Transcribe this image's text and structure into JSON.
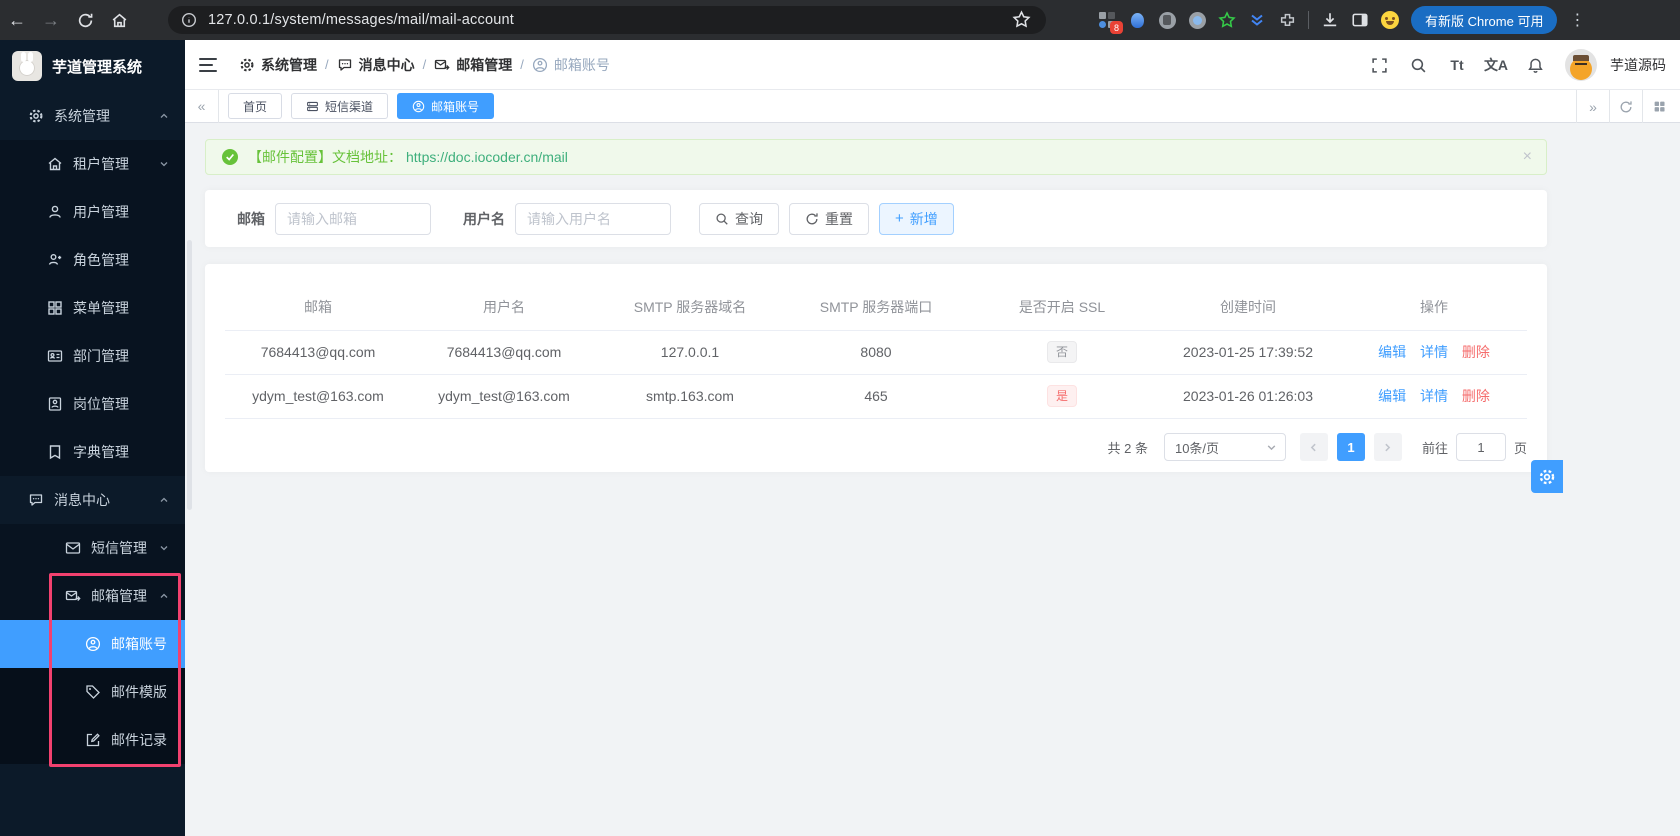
{
  "browser": {
    "url": "127.0.0.1/system/messages/mail/mail-account",
    "update_label": "有新版 Chrome 可用",
    "extension_badge": "8"
  },
  "glyphs": {
    "back": "←",
    "forward": "→",
    "collapse": "«",
    "expand": "»",
    "kebab": "⋮",
    "plus": "+",
    "slash": "/",
    "close": "×",
    "check": "✓"
  },
  "sidebar": {
    "logo_title": "芋道管理系统",
    "menu": [
      {
        "label": "系统管理"
      },
      {
        "label": "租户管理"
      },
      {
        "label": "用户管理"
      },
      {
        "label": "角色管理"
      },
      {
        "label": "菜单管理"
      },
      {
        "label": "部门管理"
      },
      {
        "label": "岗位管理"
      },
      {
        "label": "字典管理"
      },
      {
        "label": "消息中心"
      },
      {
        "label": "短信管理"
      },
      {
        "label": "邮箱管理"
      },
      {
        "label": "邮箱账号"
      },
      {
        "label": "邮件模版"
      },
      {
        "label": "邮件记录"
      }
    ]
  },
  "header": {
    "breadcrumb": [
      "系统管理",
      "消息中心",
      "邮箱管理",
      "邮箱账号"
    ],
    "font_icon": "Tt",
    "lang_icon": "文A",
    "username": "芋道源码"
  },
  "tabs": [
    {
      "label": "首页"
    },
    {
      "label": "短信渠道"
    },
    {
      "label": "邮箱账号"
    }
  ],
  "alert": {
    "text": "【邮件配置】文档地址：",
    "link": "https://doc.iocoder.cn/mail"
  },
  "filters": {
    "email_label": "邮箱",
    "email_placeholder": "请输入邮箱",
    "username_label": "用户名",
    "username_placeholder": "请输入用户名",
    "search": "查询",
    "reset": "重置",
    "add": "新增"
  },
  "table": {
    "columns": [
      "邮箱",
      "用户名",
      "SMTP 服务器域名",
      "SMTP 服务器端口",
      "是否开启 SSL",
      "创建时间",
      "操作"
    ],
    "rows": [
      {
        "email": "7684413@qq.com",
        "username": "7684413@qq.com",
        "domain": "127.0.0.1",
        "port": "8080",
        "ssl": "否",
        "created": "2023-01-25 17:39:52"
      },
      {
        "email": "ydym_test@163.com",
        "username": "ydym_test@163.com",
        "domain": "smtp.163.com",
        "port": "465",
        "ssl": "是",
        "created": "2023-01-26 01:26:03"
      }
    ],
    "actions": {
      "edit": "编辑",
      "detail": "详情",
      "del": "删除"
    }
  },
  "pagination": {
    "total": "共 2 条",
    "page_size": "10条/页",
    "page": "1",
    "goto": "前往",
    "goto_value": "1",
    "unit": "页"
  },
  "colors": {
    "accent": "#409eff",
    "success": "#67c23a",
    "danger": "#f56c6c",
    "highlight_pink": "#f2416f"
  }
}
